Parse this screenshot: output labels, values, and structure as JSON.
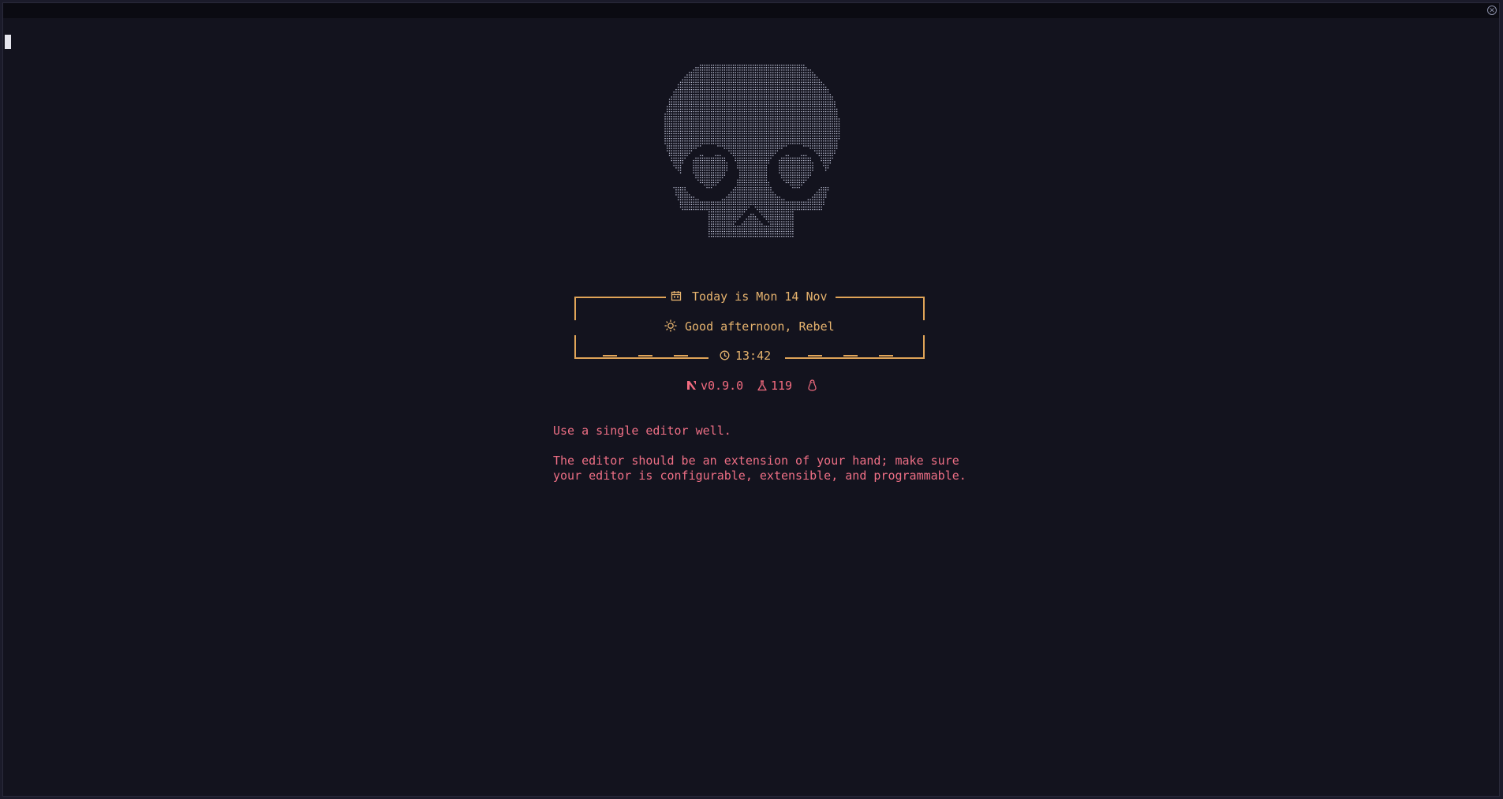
{
  "window": {
    "close_icon": "close-icon"
  },
  "dashboard": {
    "date_label": "Today is Mon 14 Nov",
    "greeting": "Good afternoon, Rebel",
    "time": "13:42",
    "version": "v0.9.0",
    "plugins_count": "119",
    "icons": {
      "date": "calendar-icon",
      "greeting": "sun-icon",
      "time": "clock-icon",
      "version": "neovim-logo-icon",
      "plugins": "flask-icon",
      "os": "linux-penguin-icon"
    }
  },
  "quote": {
    "line1": "Use a single editor well.",
    "line2": "The editor should be an extension of your hand; make sure",
    "line3": "your editor is configurable, extensible, and programmable."
  },
  "colors": {
    "background": "#13131e",
    "accent_orange": "#e6b36e",
    "accent_pink": "#f26b7f",
    "ascii_art": "#c8cbe0"
  }
}
